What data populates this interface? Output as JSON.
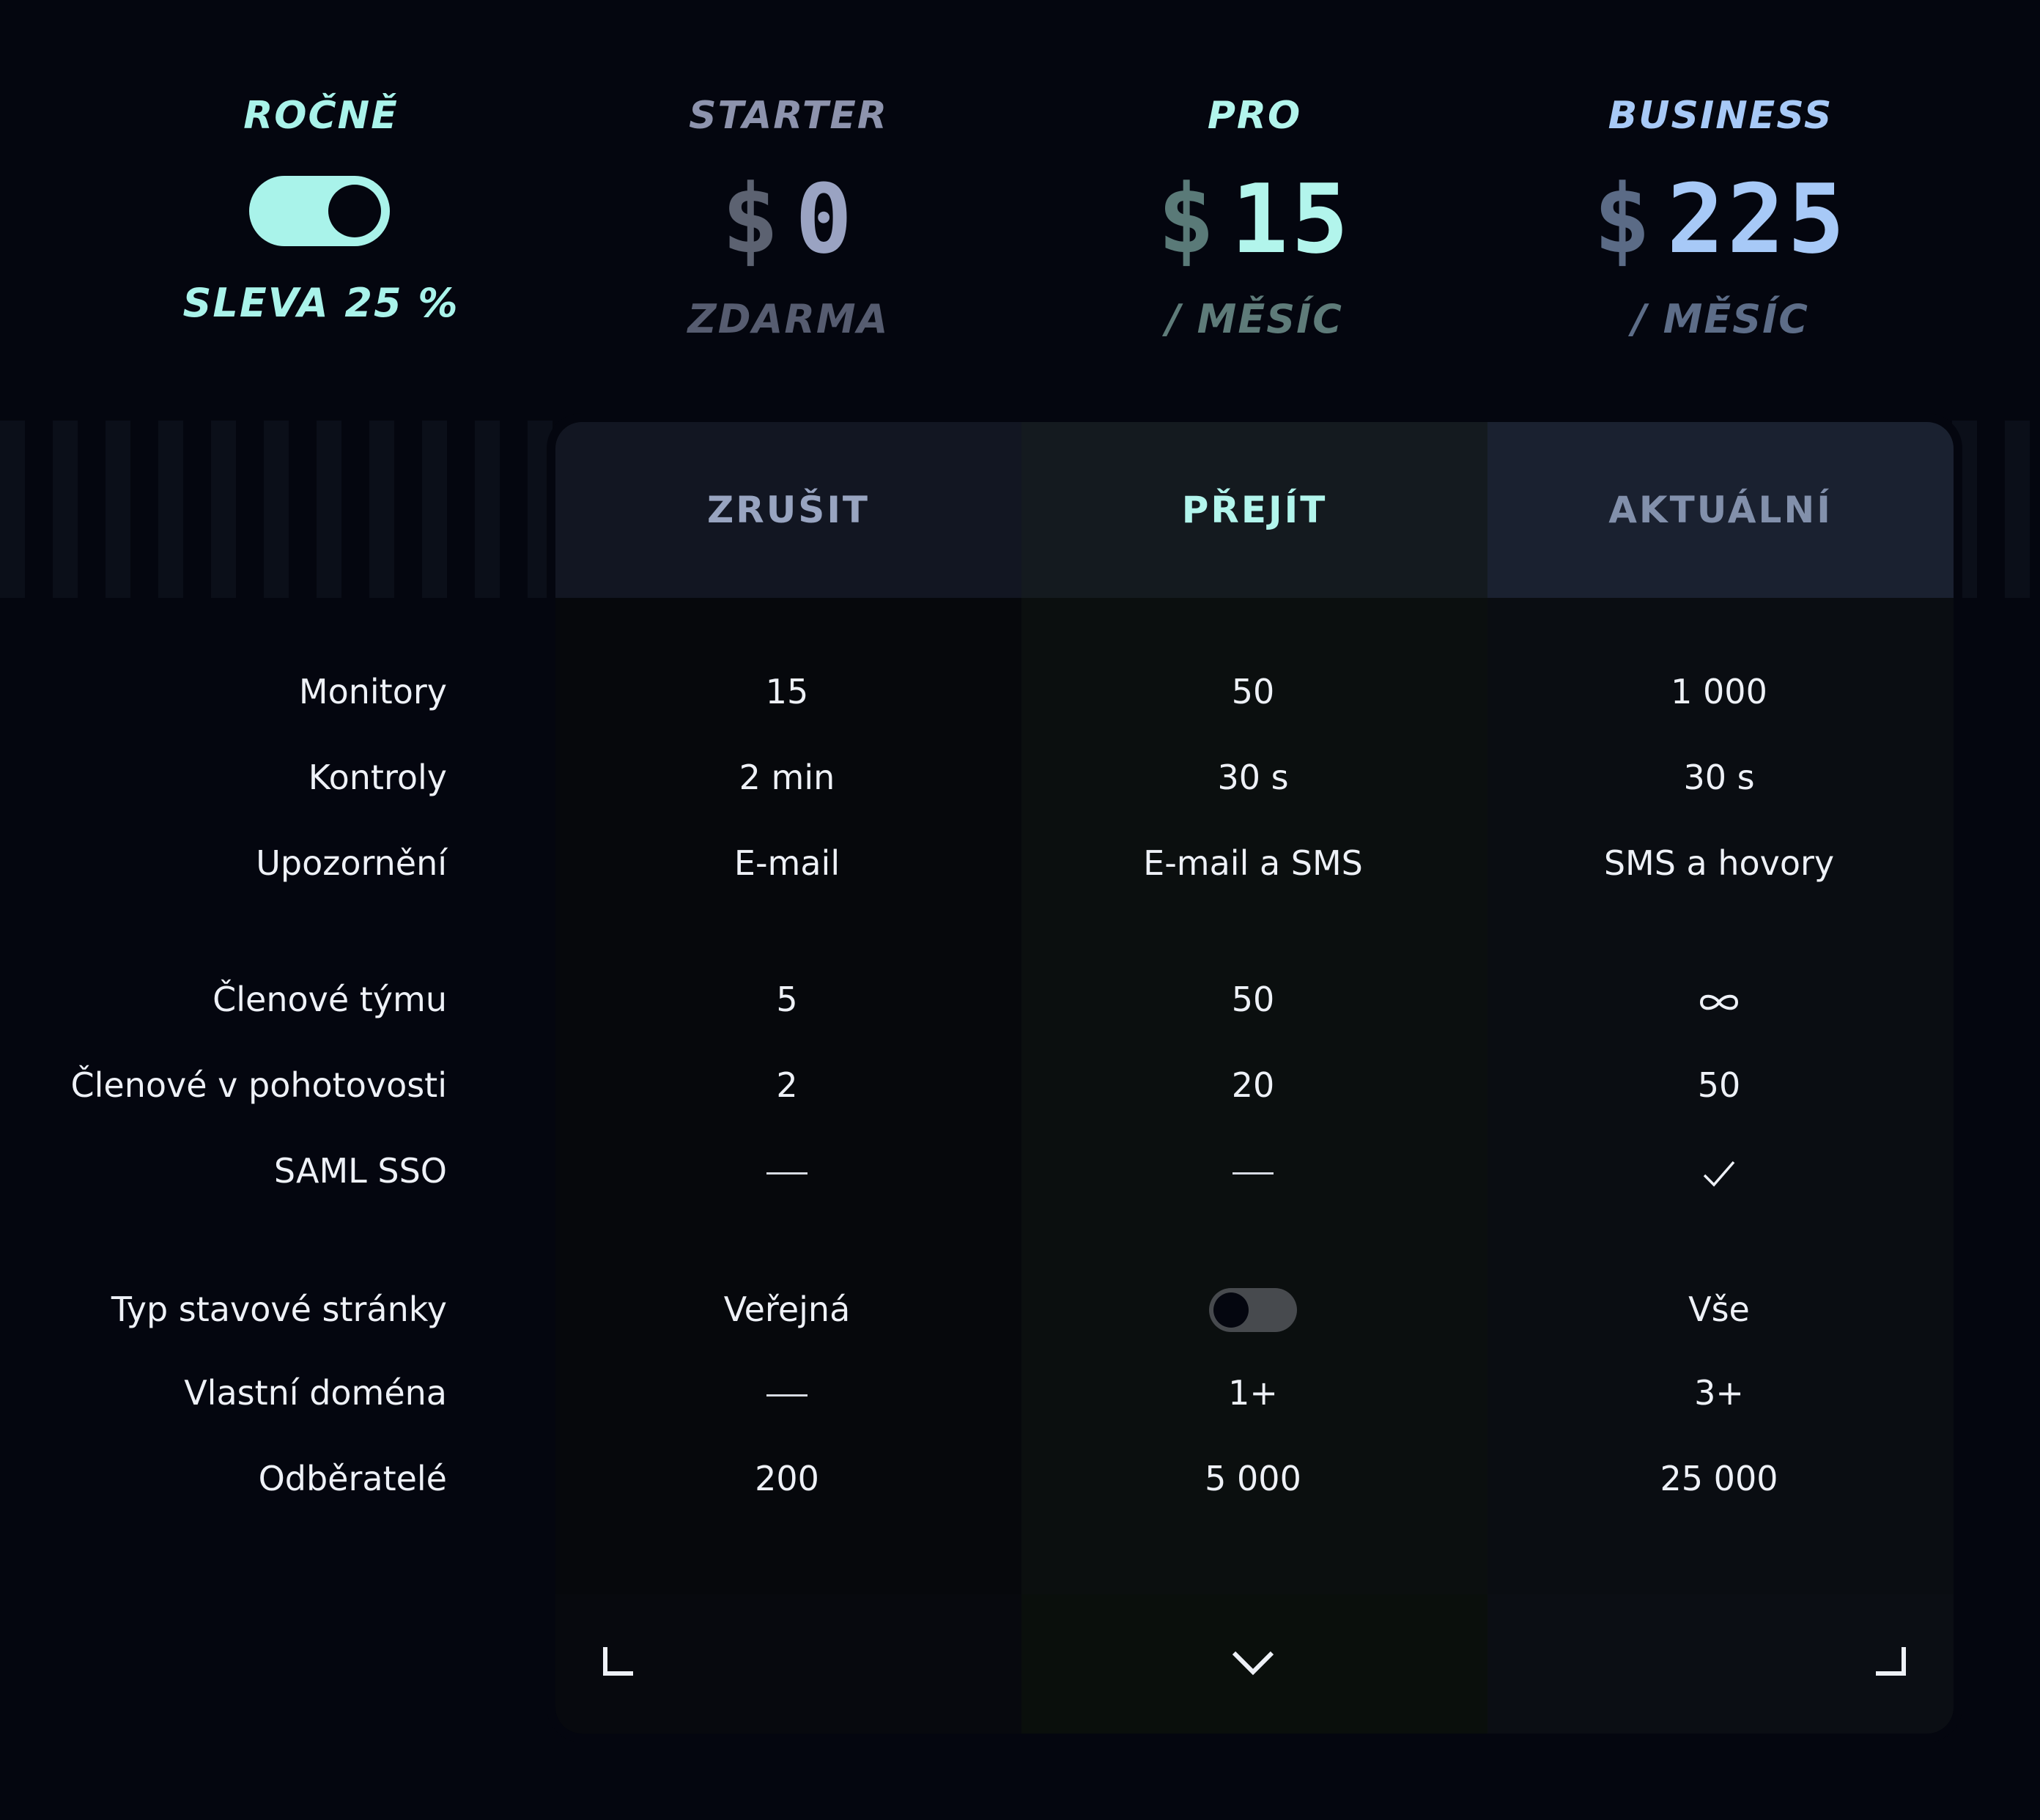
{
  "billing": {
    "period_label": "ROČNĚ",
    "toggle_on": true,
    "discount_label": "SLEVA 25 %"
  },
  "plans": [
    {
      "name": "STARTER",
      "currency": "$",
      "amount": "0",
      "sub": "ZDARMA",
      "action": "ZRUŠIT"
    },
    {
      "name": "PRO",
      "currency": "$",
      "amount": "15",
      "sub": "/ MĚSÍC",
      "action": "PŘEJÍT"
    },
    {
      "name": "BUSINESS",
      "currency": "$",
      "amount": "225",
      "sub": "/ MĚSÍC",
      "action": "AKTUÁLNÍ"
    }
  ],
  "features": {
    "monitors": {
      "label": "Monitory",
      "values": [
        "15",
        "50",
        "1 000"
      ]
    },
    "checks": {
      "label": "Kontroly",
      "values": [
        "2 min",
        "30 s",
        "30 s"
      ]
    },
    "alerts": {
      "label": "Upozornění",
      "values": [
        "E-mail",
        "E-mail a SMS",
        "SMS a hovory"
      ]
    },
    "team": {
      "label": "Členové týmu",
      "values": [
        "5",
        "50",
        "∞"
      ]
    },
    "oncall": {
      "label": "Členové v pohotovosti",
      "values": [
        "2",
        "20",
        "50"
      ]
    },
    "saml": {
      "label": "SAML SSO",
      "values": [
        "—",
        "—",
        "✓"
      ]
    },
    "status_page": {
      "label": "Typ stavové stránky",
      "values": [
        "Veřejná",
        "",
        "Vše"
      ],
      "pro_toggle_on": false
    },
    "domain": {
      "label": "Vlastní doména",
      "values": [
        "—",
        "1+",
        "3+"
      ]
    },
    "subscribers": {
      "label": "Odběratelé",
      "values": [
        "200",
        "5 000",
        "25 000"
      ]
    }
  },
  "colors": {
    "background": "#04060f",
    "accent": "#a9f3ea",
    "starter_price": "#9aa3c2",
    "pro_price": "#b2f5ec",
    "business_price": "#a7c9f7"
  },
  "icons": {
    "corner_left": "corner-bracket-left-icon",
    "expand": "chevron-down-icon",
    "corner_right": "corner-bracket-right-icon"
  }
}
